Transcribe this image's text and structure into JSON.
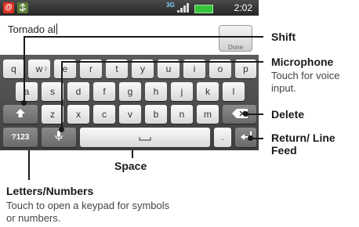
{
  "statusbar": {
    "notif_email": "@",
    "network": "3G",
    "time": "2:02"
  },
  "text_field": {
    "value": "Tornado al"
  },
  "done_button": {
    "label": "Done"
  },
  "keyboard": {
    "row1": [
      {
        "label": "q"
      },
      {
        "label": "w",
        "sup": "2"
      },
      {
        "label": "e"
      },
      {
        "label": "r"
      },
      {
        "label": "t"
      },
      {
        "label": "y"
      },
      {
        "label": "u"
      },
      {
        "label": "i"
      },
      {
        "label": "o"
      },
      {
        "label": "p"
      }
    ],
    "row2": [
      {
        "label": "a"
      },
      {
        "label": "s"
      },
      {
        "label": "d"
      },
      {
        "label": "f"
      },
      {
        "label": "g"
      },
      {
        "label": "h"
      },
      {
        "label": "j"
      },
      {
        "label": "k"
      },
      {
        "label": "l"
      }
    ],
    "row3": [
      {
        "label": "z"
      },
      {
        "label": "x"
      },
      {
        "label": "c"
      },
      {
        "label": "v"
      },
      {
        "label": "b"
      },
      {
        "label": "n"
      },
      {
        "label": "m"
      }
    ],
    "numbers_key": "?123",
    "period_key": "."
  },
  "callouts": {
    "shift": "Shift",
    "microphone": "Microphone",
    "microphone_desc": "Touch for voice input.",
    "delete": "Delete",
    "return": "Return/ Line Feed",
    "space": "Space",
    "letters_numbers": "Letters/Numbers",
    "letters_numbers_desc": "Touch to open a keypad for symbols or numbers."
  }
}
